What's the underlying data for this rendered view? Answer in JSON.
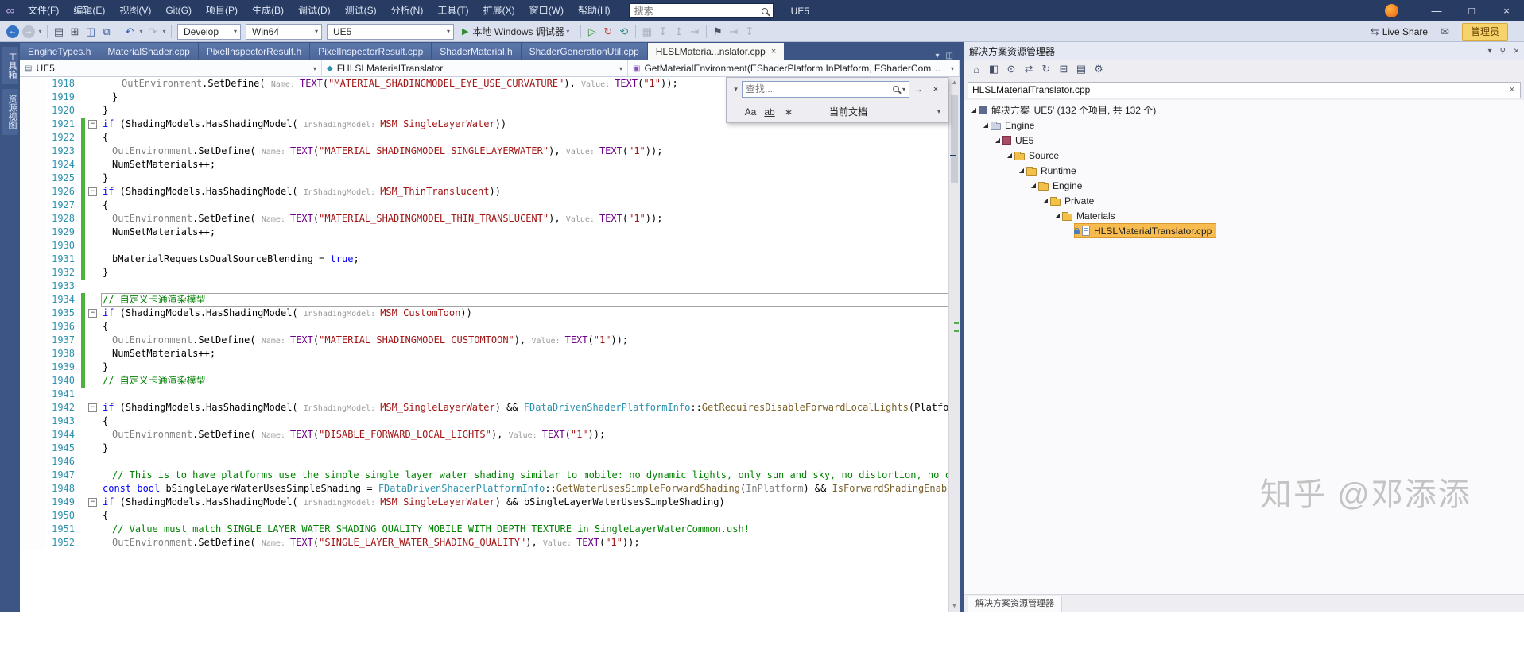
{
  "titlebar": {
    "title": "UE5",
    "search_placeholder": "搜索",
    "menu_items": [
      "文件(F)",
      "编辑(E)",
      "视图(V)",
      "Git(G)",
      "项目(P)",
      "生成(B)",
      "调试(D)",
      "测试(S)",
      "分析(N)",
      "工具(T)",
      "扩展(X)",
      "窗口(W)",
      "帮助(H)"
    ]
  },
  "toolbar": {
    "config": "Develop",
    "platform": "Win64",
    "startup_project": "UE5",
    "debug_target": "本地 Windows 调试器",
    "live_share": "Live Share",
    "admin": "管理员"
  },
  "side_tabs": [
    {
      "label": "工具箱"
    },
    {
      "label": "资源视图"
    }
  ],
  "doc_tabs": [
    {
      "label": "EngineTypes.h",
      "active": false
    },
    {
      "label": "MaterialShader.cpp",
      "active": false
    },
    {
      "label": "PixelInspectorResult.h",
      "active": false
    },
    {
      "label": "PixelInspectorResult.cpp",
      "active": false
    },
    {
      "label": "ShaderMaterial.h",
      "active": false
    },
    {
      "label": "ShaderGenerationUtil.cpp",
      "active": false
    },
    {
      "label": "HLSLMateria...nslator.cpp",
      "active": true
    }
  ],
  "navbar": {
    "scope": "UE5",
    "type": "FHLSLMaterialTranslator",
    "member": "GetMaterialEnvironment(EShaderPlatform InPlatform, FShaderCompilerEnvi"
  },
  "find": {
    "placeholder": "查找...",
    "match_case": "Aa",
    "whole_word": "ab",
    "regex": "∗",
    "scope": "当前文档"
  },
  "editor": {
    "lines": [
      {
        "n": 1918,
        "ind": 24,
        "chg": false,
        "fold": false,
        "box": false,
        "segs": [
          [
            "g",
            "OutEnvironment"
          ],
          [
            "p",
            ".SetDefine( "
          ],
          [
            "h",
            "Name: "
          ],
          [
            "m",
            "TEXT"
          ],
          [
            "p",
            "("
          ],
          [
            "s",
            "\"MATERIAL_SHADINGMODEL_EYE_USE_CURVATURE\""
          ],
          [
            "p",
            "), "
          ],
          [
            "h",
            "Value: "
          ],
          [
            "m",
            "TEXT"
          ],
          [
            "p",
            "("
          ],
          [
            "s",
            "\"1\""
          ],
          [
            "p",
            "));"
          ]
        ]
      },
      {
        "n": 1919,
        "ind": 12,
        "chg": false,
        "fold": false,
        "box": false,
        "segs": [
          [
            "p",
            "}"
          ]
        ]
      },
      {
        "n": 1920,
        "ind": 0,
        "chg": false,
        "fold": false,
        "box": false,
        "segs": [
          [
            "p",
            "}"
          ]
        ]
      },
      {
        "n": 1921,
        "ind": 0,
        "chg": true,
        "fold": true,
        "box": false,
        "segs": [
          [
            "k",
            "if"
          ],
          [
            "p",
            " (ShadingModels.HasShadingModel( "
          ],
          [
            "h",
            "InShadingModel: "
          ],
          [
            "e",
            "MSM_SingleLayerWater"
          ],
          [
            "p",
            "))"
          ]
        ]
      },
      {
        "n": 1922,
        "ind": 0,
        "chg": true,
        "fold": false,
        "box": false,
        "segs": [
          [
            "p",
            "{"
          ]
        ]
      },
      {
        "n": 1923,
        "ind": 12,
        "chg": true,
        "fold": false,
        "box": false,
        "segs": [
          [
            "g",
            "OutEnvironment"
          ],
          [
            "p",
            ".SetDefine( "
          ],
          [
            "h",
            "Name: "
          ],
          [
            "m",
            "TEXT"
          ],
          [
            "p",
            "("
          ],
          [
            "s",
            "\"MATERIAL_SHADINGMODEL_SINGLELAYERWATER\""
          ],
          [
            "p",
            "), "
          ],
          [
            "h",
            "Value: "
          ],
          [
            "m",
            "TEXT"
          ],
          [
            "p",
            "("
          ],
          [
            "s",
            "\"1\""
          ],
          [
            "p",
            "));"
          ]
        ]
      },
      {
        "n": 1924,
        "ind": 12,
        "chg": true,
        "fold": false,
        "box": false,
        "segs": [
          [
            "p",
            "NumSetMaterials++;"
          ]
        ]
      },
      {
        "n": 1925,
        "ind": 0,
        "chg": true,
        "fold": false,
        "box": false,
        "segs": [
          [
            "p",
            "}"
          ]
        ]
      },
      {
        "n": 1926,
        "ind": 0,
        "chg": true,
        "fold": true,
        "box": false,
        "segs": [
          [
            "k",
            "if"
          ],
          [
            "p",
            " (ShadingModels.HasShadingModel( "
          ],
          [
            "h",
            "InShadingModel: "
          ],
          [
            "e",
            "MSM_ThinTranslucent"
          ],
          [
            "p",
            "))"
          ]
        ]
      },
      {
        "n": 1927,
        "ind": 0,
        "chg": true,
        "fold": false,
        "box": false,
        "segs": [
          [
            "p",
            "{"
          ]
        ]
      },
      {
        "n": 1928,
        "ind": 12,
        "chg": true,
        "fold": false,
        "box": false,
        "segs": [
          [
            "g",
            "OutEnvironment"
          ],
          [
            "p",
            ".SetDefine( "
          ],
          [
            "h",
            "Name: "
          ],
          [
            "m",
            "TEXT"
          ],
          [
            "p",
            "("
          ],
          [
            "s",
            "\"MATERIAL_SHADINGMODEL_THIN_TRANSLUCENT\""
          ],
          [
            "p",
            "), "
          ],
          [
            "h",
            "Value: "
          ],
          [
            "m",
            "TEXT"
          ],
          [
            "p",
            "("
          ],
          [
            "s",
            "\"1\""
          ],
          [
            "p",
            "));"
          ]
        ]
      },
      {
        "n": 1929,
        "ind": 12,
        "chg": true,
        "fold": false,
        "box": false,
        "segs": [
          [
            "p",
            "NumSetMaterials++;"
          ]
        ]
      },
      {
        "n": 1930,
        "ind": 0,
        "chg": true,
        "fold": false,
        "box": false,
        "segs": []
      },
      {
        "n": 1931,
        "ind": 12,
        "chg": true,
        "fold": false,
        "box": false,
        "segs": [
          [
            "p",
            "bMaterialRequestsDualSourceBlending = "
          ],
          [
            "k",
            "true"
          ],
          [
            "p",
            ";"
          ]
        ]
      },
      {
        "n": 1932,
        "ind": 0,
        "chg": true,
        "fold": false,
        "box": false,
        "segs": [
          [
            "p",
            "}"
          ]
        ]
      },
      {
        "n": 1933,
        "ind": 0,
        "chg": false,
        "fold": false,
        "box": false,
        "segs": []
      },
      {
        "n": 1934,
        "ind": 0,
        "chg": true,
        "fold": false,
        "box": true,
        "segs": [
          [
            "c",
            "// 自定义卡通渲染模型"
          ]
        ]
      },
      {
        "n": 1935,
        "ind": 0,
        "chg": true,
        "fold": true,
        "box": false,
        "segs": [
          [
            "k",
            "if"
          ],
          [
            "p",
            " (ShadingModels.HasShadingModel( "
          ],
          [
            "h",
            "InShadingModel: "
          ],
          [
            "e",
            "MSM_CustomToon"
          ],
          [
            "p",
            "))"
          ]
        ]
      },
      {
        "n": 1936,
        "ind": 0,
        "chg": true,
        "fold": false,
        "box": false,
        "segs": [
          [
            "p",
            "{"
          ]
        ]
      },
      {
        "n": 1937,
        "ind": 12,
        "chg": true,
        "fold": false,
        "box": false,
        "segs": [
          [
            "g",
            "OutEnvironment"
          ],
          [
            "p",
            ".SetDefine( "
          ],
          [
            "h",
            "Name: "
          ],
          [
            "m",
            "TEXT"
          ],
          [
            "p",
            "("
          ],
          [
            "s",
            "\"MATERIAL_SHADINGMODEL_CUSTOMTOON\""
          ],
          [
            "p",
            "), "
          ],
          [
            "h",
            "Value: "
          ],
          [
            "m",
            "TEXT"
          ],
          [
            "p",
            "("
          ],
          [
            "s",
            "\"1\""
          ],
          [
            "p",
            "));"
          ]
        ]
      },
      {
        "n": 1938,
        "ind": 12,
        "chg": true,
        "fold": false,
        "box": false,
        "segs": [
          [
            "p",
            "NumSetMaterials++;"
          ]
        ]
      },
      {
        "n": 1939,
        "ind": 0,
        "chg": true,
        "fold": false,
        "box": false,
        "segs": [
          [
            "p",
            "}"
          ]
        ]
      },
      {
        "n": 1940,
        "ind": 0,
        "chg": true,
        "fold": false,
        "box": false,
        "segs": [
          [
            "c",
            "// 自定义卡通渲染模型"
          ]
        ]
      },
      {
        "n": 1941,
        "ind": 0,
        "chg": false,
        "fold": false,
        "box": false,
        "segs": []
      },
      {
        "n": 1942,
        "ind": 0,
        "chg": false,
        "fold": true,
        "box": false,
        "segs": [
          [
            "k",
            "if"
          ],
          [
            "p",
            " (ShadingModels.HasShadingModel( "
          ],
          [
            "h",
            "InShadingModel: "
          ],
          [
            "e",
            "MSM_SingleLayerWater"
          ],
          [
            "p",
            ") && "
          ],
          [
            "t",
            "FDataDrivenShaderPlatformInfo"
          ],
          [
            "p",
            "::"
          ],
          [
            "f",
            "GetRequiresDisableForwardLocalLights"
          ],
          [
            "p",
            "(Platform))"
          ]
        ]
      },
      {
        "n": 1943,
        "ind": 0,
        "chg": false,
        "fold": false,
        "box": false,
        "segs": [
          [
            "p",
            "{"
          ]
        ]
      },
      {
        "n": 1944,
        "ind": 12,
        "chg": false,
        "fold": false,
        "box": false,
        "segs": [
          [
            "g",
            "OutEnvironment"
          ],
          [
            "p",
            ".SetDefine( "
          ],
          [
            "h",
            "Name: "
          ],
          [
            "m",
            "TEXT"
          ],
          [
            "p",
            "("
          ],
          [
            "s",
            "\"DISABLE_FORWARD_LOCAL_LIGHTS\""
          ],
          [
            "p",
            "), "
          ],
          [
            "h",
            "Value: "
          ],
          [
            "m",
            "TEXT"
          ],
          [
            "p",
            "("
          ],
          [
            "s",
            "\"1\""
          ],
          [
            "p",
            "));"
          ]
        ]
      },
      {
        "n": 1945,
        "ind": 0,
        "chg": false,
        "fold": false,
        "box": false,
        "segs": [
          [
            "p",
            "}"
          ]
        ]
      },
      {
        "n": 1946,
        "ind": 0,
        "chg": false,
        "fold": false,
        "box": false,
        "segs": []
      },
      {
        "n": 1947,
        "ind": 12,
        "chg": false,
        "fold": false,
        "box": false,
        "segs": [
          [
            "c",
            "// This is to have platforms use the simple single layer water shading similar to mobile: no dynamic lights, only sun and sky, no distortion, no colored transmittance on background, no custom depth read."
          ]
        ]
      },
      {
        "n": 1948,
        "ind": 0,
        "chg": false,
        "fold": false,
        "box": false,
        "segs": [
          [
            "k",
            "const"
          ],
          [
            "p",
            " "
          ],
          [
            "k",
            "bool"
          ],
          [
            "p",
            " bSingleLayerWaterUsesSimpleShading = "
          ],
          [
            "t",
            "FDataDrivenShaderPlatformInfo"
          ],
          [
            "p",
            "::"
          ],
          [
            "f",
            "GetWaterUsesSimpleForwardShading"
          ],
          [
            "p",
            "("
          ],
          [
            "g",
            "InPlatform"
          ],
          [
            "p",
            ") && "
          ],
          [
            "f",
            "IsForwardShadingEnabled"
          ],
          [
            "p",
            "("
          ],
          [
            "g",
            "InPlatform"
          ],
          [
            "p",
            ");"
          ]
        ]
      },
      {
        "n": 1949,
        "ind": 0,
        "chg": false,
        "fold": true,
        "box": false,
        "segs": [
          [
            "k",
            "if"
          ],
          [
            "p",
            " (ShadingModels.HasShadingModel( "
          ],
          [
            "h",
            "InShadingModel: "
          ],
          [
            "e",
            "MSM_SingleLayerWater"
          ],
          [
            "p",
            ") && bSingleLayerWaterUsesSimpleShading)"
          ]
        ]
      },
      {
        "n": 1950,
        "ind": 0,
        "chg": false,
        "fold": false,
        "box": false,
        "segs": [
          [
            "p",
            "{"
          ]
        ]
      },
      {
        "n": 1951,
        "ind": 12,
        "chg": false,
        "fold": false,
        "box": false,
        "segs": [
          [
            "c",
            "// Value must match SINGLE_LAYER_WATER_SHADING_QUALITY_MOBILE_WITH_DEPTH_TEXTURE in SingleLayerWaterCommon.ush!"
          ]
        ]
      },
      {
        "n": 1952,
        "ind": 12,
        "chg": false,
        "fold": false,
        "box": false,
        "segs": [
          [
            "g",
            "OutEnvironment"
          ],
          [
            "p",
            ".SetDefine( "
          ],
          [
            "h",
            "Name: "
          ],
          [
            "m",
            "TEXT"
          ],
          [
            "p",
            "("
          ],
          [
            "s",
            "\"SINGLE_LAYER_WATER_SHADING_QUALITY\""
          ],
          [
            "p",
            "), "
          ],
          [
            "h",
            "Value: "
          ],
          [
            "m",
            "TEXT"
          ],
          [
            "p",
            "("
          ],
          [
            "s",
            "\"1\""
          ],
          [
            "p",
            "));"
          ]
        ]
      }
    ]
  },
  "solution_explorer": {
    "title": "解决方案资源管理器",
    "search_value": "HLSLMaterialTranslator.cpp",
    "bottom_tab": "解决方案资源管理器",
    "tree": [
      {
        "label": "解决方案 'UE5' (132 个项目, 共 132 个)",
        "level": 0,
        "icon": "solution",
        "expander": true,
        "selected": false,
        "lock": false
      },
      {
        "label": "Engine",
        "level": 1,
        "icon": "folder-gray",
        "expander": true,
        "selected": false,
        "lock": false
      },
      {
        "label": "UE5",
        "level": 2,
        "icon": "project",
        "expander": true,
        "selected": false,
        "lock": false
      },
      {
        "label": "Source",
        "level": 3,
        "icon": "folder",
        "expander": true,
        "selected": false,
        "lock": false
      },
      {
        "label": "Runtime",
        "level": 4,
        "icon": "folder",
        "expander": true,
        "selected": false,
        "lock": false
      },
      {
        "label": "Engine",
        "level": 5,
        "icon": "folder",
        "expander": true,
        "selected": false,
        "lock": false
      },
      {
        "label": "Private",
        "level": 6,
        "icon": "folder",
        "expander": true,
        "selected": false,
        "lock": false
      },
      {
        "label": "Materials",
        "level": 7,
        "icon": "folder",
        "expander": true,
        "selected": false,
        "lock": false
      },
      {
        "label": "HLSLMaterialTranslator.cpp",
        "level": 8,
        "icon": "file",
        "expander": false,
        "selected": true,
        "lock": true
      }
    ]
  },
  "watermark": "知乎 @邓添添",
  "icons": {
    "vs_logo": "∞",
    "back": "←",
    "forward": "→",
    "new_file": "▤",
    "open_file": "⊞",
    "save": "◫",
    "save_all": "⧉",
    "undo": "↶",
    "redo": "↷",
    "caret_down": "▾",
    "play_solid": "▶",
    "play_outline": "▷",
    "hot_reload": "↻",
    "refresh": "⟲",
    "gray1": "▦",
    "gray2": "↧",
    "gray3": "↥",
    "gray4": "⇥",
    "bookmark": "⚑",
    "liveshare": "⇆",
    "feedback": "✉",
    "minimize": "—",
    "maximize": "□",
    "close": "×",
    "tab_caret": "▾",
    "tab_windows": "◫",
    "nav_scope": "▤",
    "nav_type": "◆",
    "nav_member": "▣",
    "find_chevron": "▾",
    "find_next": "→",
    "find_close": "×",
    "scroll_up": "▲",
    "scroll_down": "▼",
    "se_home": "⌂",
    "se_switch": "◧",
    "se_sync": "⊙",
    "se_compare": "⇄",
    "se_refresh": "↻",
    "se_collapse": "⊟",
    "se_showall": "▤",
    "se_props": "⚙",
    "panel_menu": "▾",
    "panel_pin": "⚲",
    "panel_close": "×",
    "tree_expanded": "◢",
    "fold_minus": "−"
  }
}
